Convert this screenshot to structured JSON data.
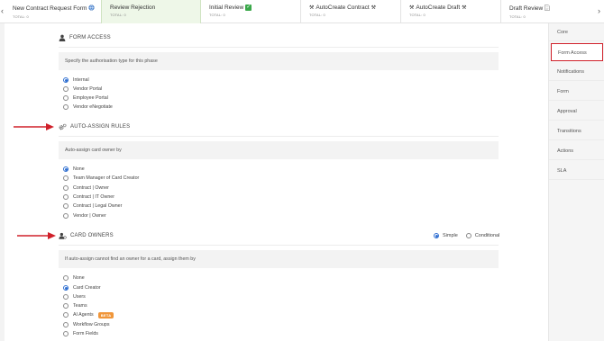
{
  "tabs": [
    {
      "name": "New Contract Request Form",
      "icon": "globe-icon",
      "total": "TOTAL: 0"
    },
    {
      "name": "Review Rejection",
      "icon": "",
      "total": "TOTAL: 0"
    },
    {
      "name": "Initial Review",
      "icon": "check-icon",
      "total": "TOTAL: 0"
    },
    {
      "name": "AutoCreate Contract",
      "icon": "tools-icon",
      "total": "TOTAL: 0"
    },
    {
      "name": "AutoCreate Draft",
      "icon": "tools-icon",
      "total": "TOTAL: 0"
    },
    {
      "name": "Draft Review",
      "icon": "document-icon",
      "total": "TOTAL: 0"
    }
  ],
  "right_nav": [
    "Core",
    "Form Access",
    "Notifications",
    "Form",
    "Approval",
    "Transitions",
    "Actions",
    "SLA"
  ],
  "form_access": {
    "title": "FORM ACCESS",
    "prompt": "Specify the authorisation type for this phase",
    "options": [
      "Internal",
      "Vendor Portal",
      "Employee Portal",
      "Vendor eNegotiate"
    ],
    "selected": "Internal"
  },
  "auto_assign": {
    "title": "AUTO-ASSIGN RULES",
    "prompt": "Auto-assign card owner by",
    "options": [
      "None",
      "Team Manager of Card Creator",
      "Contract | Owner",
      "Contract | IT Owner",
      "Contract | Legal Owner",
      "Vendor | Owner"
    ],
    "selected": "None"
  },
  "card_owners": {
    "title": "CARD OWNERS",
    "mode_options": [
      "Simple",
      "Conditional"
    ],
    "mode_selected": "Simple",
    "prompt": "If auto-assign cannot find an owner for a card, assign them by",
    "options": [
      "None",
      "Card Creator",
      "Users",
      "Teams",
      "AI Agents",
      "Workflow Groups",
      "Form Fields"
    ],
    "selected": "Card Creator",
    "beta_label": "BETA"
  },
  "colors": {
    "accent": "#2f6fd1",
    "highlight": "#d0202a",
    "active_tab": "#eef7e8",
    "beta": "#f0963a"
  }
}
